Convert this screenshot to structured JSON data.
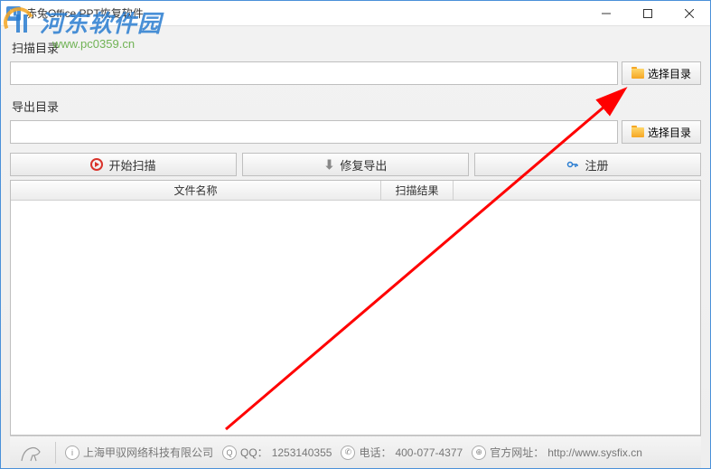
{
  "window": {
    "title": "赤兔Office PPT恢复软件"
  },
  "labels": {
    "scan_dir": "扫描目录",
    "export_dir": "导出目录",
    "browse": "选择目录"
  },
  "inputs": {
    "scan_path": "",
    "export_path": ""
  },
  "actions": {
    "start_scan": "开始扫描",
    "repair_export": "修复导出",
    "register": "注册"
  },
  "table": {
    "col_filename": "文件名称",
    "col_scan_result": "扫描结果",
    "rows": []
  },
  "statusbar": {
    "company": "上海甲驭网络科技有限公司",
    "qq_label": "QQ：",
    "qq_value": "1253140355",
    "phone_label": "电话：",
    "phone_value": "400-077-4377",
    "site_label": "官方网址：",
    "site_url": "http://www.sysfix.cn"
  },
  "watermark": {
    "text": "河东软件园",
    "url": "www.pc0359.cn"
  }
}
